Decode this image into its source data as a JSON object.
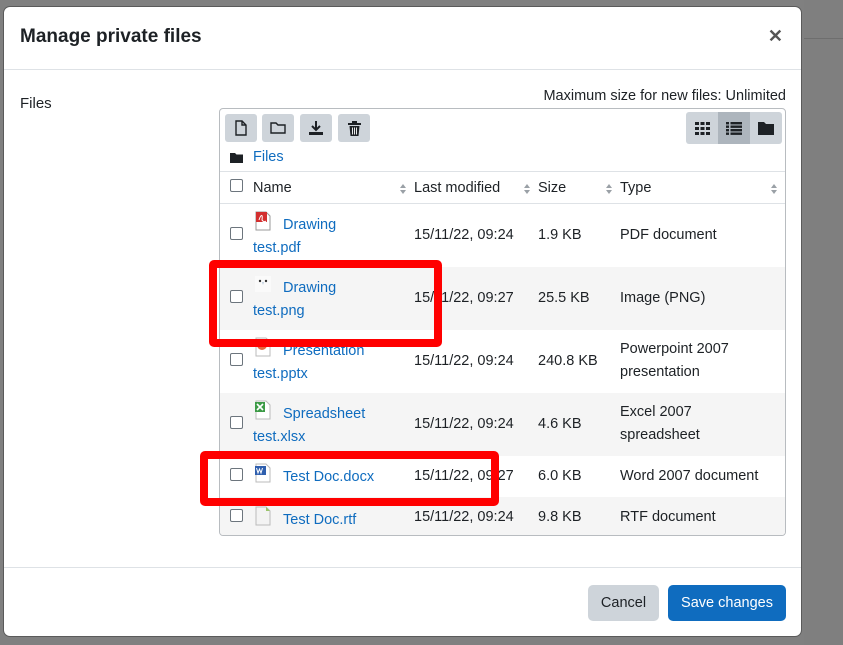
{
  "dialog": {
    "title": "Manage private files",
    "close_icon": "close-icon",
    "files_label": "Files",
    "max_size": "Maximum size for new files: Unlimited"
  },
  "toolbar": {
    "buttons": [
      "add-file-icon",
      "create-folder-icon",
      "download-icon",
      "delete-icon"
    ],
    "views": [
      "grid-view-icon",
      "list-view-icon",
      "folder-tree-icon"
    ],
    "active_view": "list-view-icon"
  },
  "breadcrumb": {
    "label": "Files"
  },
  "table": {
    "headers": {
      "name": "Name",
      "modified": "Last modified",
      "size": "Size",
      "type": "Type"
    },
    "rows": [
      {
        "name_line1": "Drawing",
        "name_line2": "test.pdf",
        "modified": "15/11/22, 09:24",
        "size": "1.9 KB",
        "type_line1": "PDF document",
        "type_line2": "",
        "icon": "pdf-file-icon"
      },
      {
        "name_line1": "Drawing",
        "name_line2": "test.png",
        "modified": "15/11/22, 09:27",
        "size": "25.5 KB",
        "type_line1": "Image (PNG)",
        "type_line2": "",
        "icon": "image-thumbnail-icon"
      },
      {
        "name_line1": "Presentation",
        "name_line2": "test.pptx",
        "modified": "15/11/22, 09:24",
        "size": "240.8 KB",
        "type_line1": "Powerpoint 2007",
        "type_line2": "presentation",
        "icon": "powerpoint-file-icon"
      },
      {
        "name_line1": "Spreadsheet",
        "name_line2": "test.xlsx",
        "modified": "15/11/22, 09:24",
        "size": "4.6 KB",
        "type_line1": "Excel 2007",
        "type_line2": "spreadsheet",
        "icon": "excel-file-icon"
      },
      {
        "name_line1": "Test Doc.docx",
        "name_line2": "",
        "modified": "15/11/22, 09:27",
        "size": "6.0 KB",
        "type_line1": "Word 2007 document",
        "type_line2": "",
        "icon": "word-file-icon"
      },
      {
        "name_line1": "Test Doc.rtf",
        "name_line2": "",
        "modified": "15/11/22, 09:24",
        "size": "9.8 KB",
        "type_line1": "RTF document",
        "type_line2": "",
        "icon": "rtf-file-icon"
      }
    ]
  },
  "footer": {
    "cancel": "Cancel",
    "save": "Save changes"
  },
  "colors": {
    "accent": "#0f6cbf",
    "highlight": "#ff0000",
    "button_secondary": "#ced4da"
  }
}
